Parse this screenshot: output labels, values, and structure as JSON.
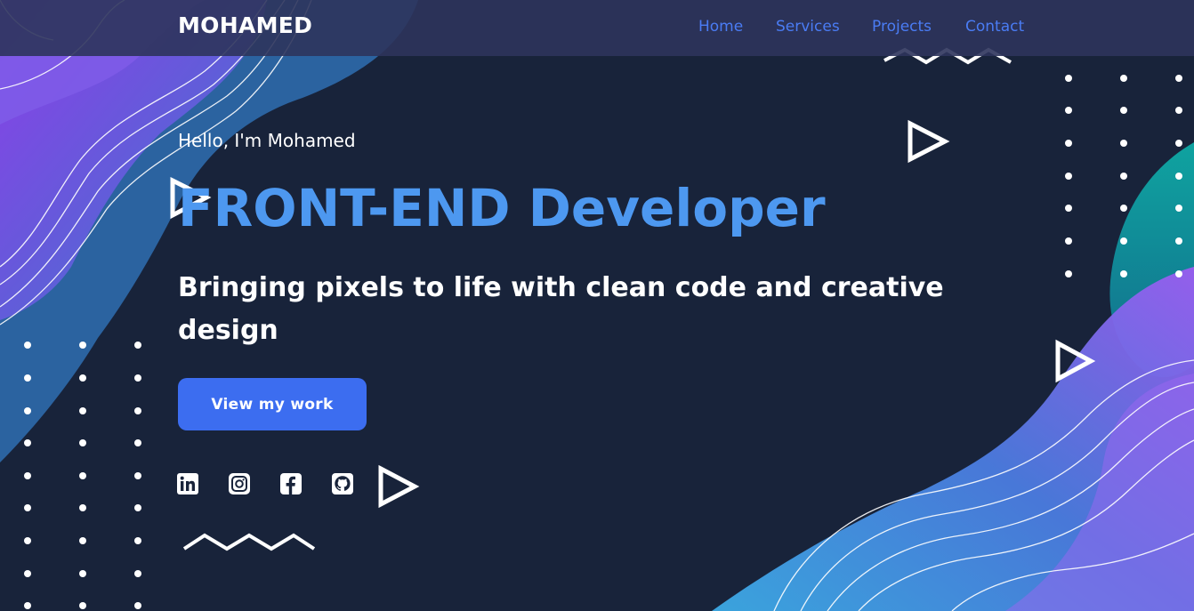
{
  "navbar": {
    "logo": "MOHAMED",
    "links": [
      {
        "label": "Home"
      },
      {
        "label": "Services"
      },
      {
        "label": "Projects"
      },
      {
        "label": "Contact"
      }
    ]
  },
  "hero": {
    "greeting": "Hello, I'm Mohamed",
    "headline": "FRONT-END Developer",
    "tagline": "Bringing pixels to life with clean code and creative design",
    "cta_label": "View my work"
  },
  "social": [
    {
      "icon": "linkedin-icon"
    },
    {
      "icon": "instagram-icon"
    },
    {
      "icon": "facebook-icon"
    },
    {
      "icon": "github-icon"
    }
  ],
  "colors": {
    "background": "#18233a",
    "navbar": "#2d345c",
    "accent": "#3c6df0",
    "headline": "#4d98f0",
    "nav_link": "#4a7cf4"
  }
}
